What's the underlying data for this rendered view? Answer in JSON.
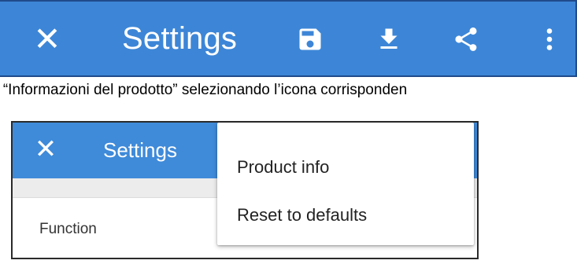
{
  "top_bar": {
    "close_glyph": "✕",
    "title": "Settings",
    "color": "#3d86d7",
    "icons": [
      "close-icon",
      "save-icon",
      "download-icon",
      "share-icon",
      "more-vert-icon"
    ]
  },
  "caption": {
    "text": "a “Informazioni del prodotto” selezionando l’icona corrisponden"
  },
  "screenshot": {
    "close_glyph": "✕",
    "title": "Settings",
    "function_label": "Function",
    "menu": {
      "items": [
        "Product info",
        "Reset to defaults"
      ]
    }
  }
}
